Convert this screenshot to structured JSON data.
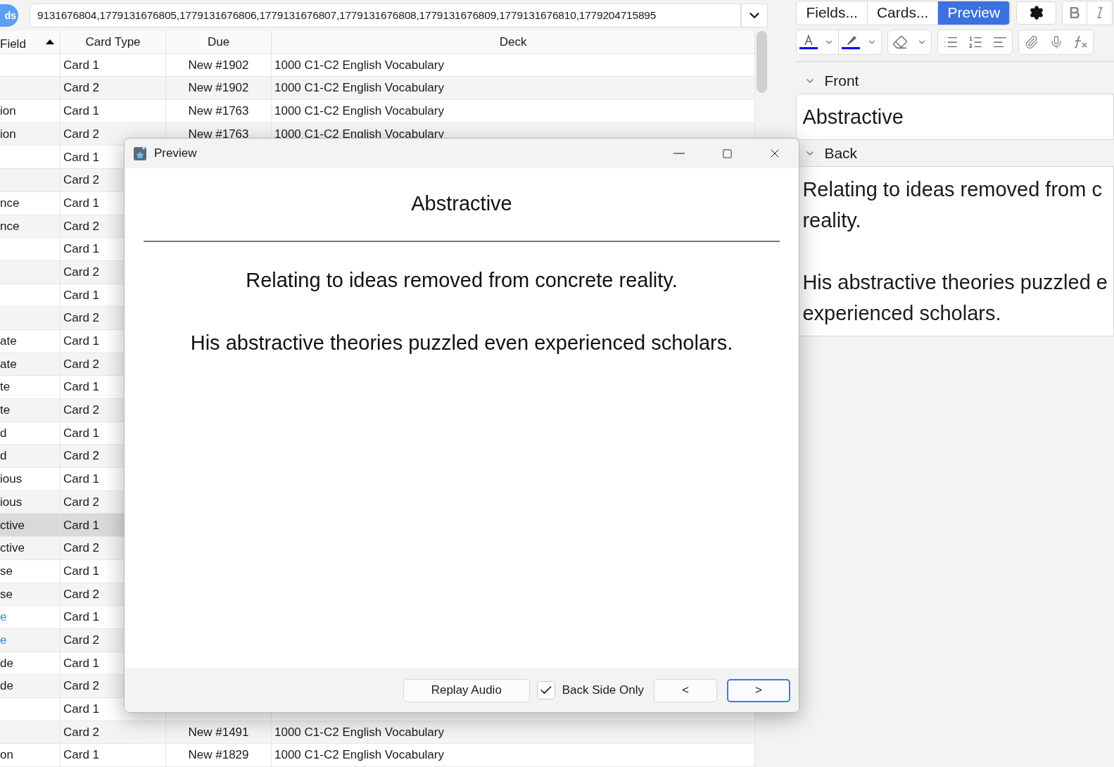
{
  "search": {
    "badge": "ds",
    "query": "9131676804,1779131676805,1779131676806,1779131676807,1779131676808,1779131676809,1779131676810,1779204715895"
  },
  "table": {
    "columns": [
      {
        "label": "Field",
        "sorted": true
      },
      {
        "label": "Card Type",
        "sorted": false
      },
      {
        "label": "Due",
        "sorted": false
      },
      {
        "label": "Deck",
        "sorted": false
      }
    ],
    "rows": [
      {
        "field": "",
        "card_type": "Card 1",
        "due": "New #1902",
        "deck": "1000 C1-C2 English Vocabulary",
        "selected": false
      },
      {
        "field": "",
        "card_type": "Card 2",
        "due": "New #1902",
        "deck": "1000 C1-C2 English Vocabulary",
        "selected": false
      },
      {
        "field": "ion",
        "card_type": "Card 1",
        "due": "New #1763",
        "deck": "1000 C1-C2 English Vocabulary",
        "selected": false
      },
      {
        "field": "ion",
        "card_type": "Card 2",
        "due": "New #1763",
        "deck": "1000 C1-C2 English Vocabulary",
        "selected": false
      },
      {
        "field": "",
        "card_type": "Card 1",
        "selected": false
      },
      {
        "field": "",
        "card_type": "Card 2",
        "selected": false
      },
      {
        "field": "nce",
        "card_type": "Card 1",
        "selected": false
      },
      {
        "field": "nce",
        "card_type": "Card 2",
        "selected": false
      },
      {
        "field": "",
        "card_type": "Card 1",
        "selected": false
      },
      {
        "field": "",
        "card_type": "Card 2",
        "selected": false
      },
      {
        "field": "",
        "card_type": "Card 1",
        "selected": false
      },
      {
        "field": "",
        "card_type": "Card 2",
        "selected": false
      },
      {
        "field": "ate",
        "card_type": "Card 1",
        "selected": false
      },
      {
        "field": "ate",
        "card_type": "Card 2",
        "selected": false
      },
      {
        "field": "te",
        "card_type": "Card 1",
        "selected": false
      },
      {
        "field": "te",
        "card_type": "Card 2",
        "selected": false
      },
      {
        "field": "d",
        "card_type": "Card 1",
        "selected": false
      },
      {
        "field": "d",
        "card_type": "Card 2",
        "selected": false
      },
      {
        "field": "ious",
        "card_type": "Card 1",
        "selected": false
      },
      {
        "field": "ious",
        "card_type": "Card 2",
        "selected": false
      },
      {
        "field": "ctive",
        "card_type": "Card 1",
        "selected": true
      },
      {
        "field": "ctive",
        "card_type": "Card 2",
        "selected": false
      },
      {
        "field": "se",
        "card_type": "Card 1",
        "selected": false
      },
      {
        "field": "se",
        "card_type": "Card 2",
        "selected": false
      },
      {
        "field": "e",
        "color": "#2f8ff0",
        "card_type": "Card 1",
        "selected": false
      },
      {
        "field": "e",
        "color": "#2f8ff0",
        "card_type": "Card 2",
        "selected": false
      },
      {
        "field": "de",
        "card_type": "Card 1",
        "selected": false
      },
      {
        "field": "de",
        "card_type": "Card 2",
        "selected": false
      },
      {
        "field": "",
        "card_type": "Card 1",
        "selected": false
      },
      {
        "field": "",
        "card_type": "Card 2",
        "due": "New #1491",
        "deck": "1000 C1-C2 English Vocabulary",
        "selected": false
      },
      {
        "field": "on",
        "card_type": "Card 1",
        "due": "New #1829",
        "deck": "1000 C1-C2 English Vocabulary",
        "selected": false
      }
    ]
  },
  "editor": {
    "tabs": [
      {
        "label": "Fields...",
        "selected": false
      },
      {
        "label": "Cards...",
        "selected": false
      },
      {
        "label": "Preview",
        "selected": true
      }
    ],
    "fields": [
      {
        "label": "Front",
        "expanded": true,
        "paragraphs": [
          [
            "Abstractive"
          ]
        ]
      },
      {
        "label": "Back",
        "expanded": true,
        "paragraphs": [
          [
            "Relating to ideas removed from c",
            "reality."
          ],
          [
            "His abstractive theories puzzled e",
            "experienced scholars."
          ]
        ]
      }
    ]
  },
  "preview": {
    "title": "Preview",
    "front": "Abstractive",
    "back": [
      "Relating to ideas removed from concrete reality.",
      "His abstractive theories puzzled even experienced scholars."
    ],
    "replay_button": "Replay Audio",
    "back_side_only": {
      "label": "Back Side Only",
      "checked": true
    },
    "nav_buttons": [
      {
        "label": "<",
        "default": false
      },
      {
        "label": ">",
        "default": true
      }
    ]
  }
}
